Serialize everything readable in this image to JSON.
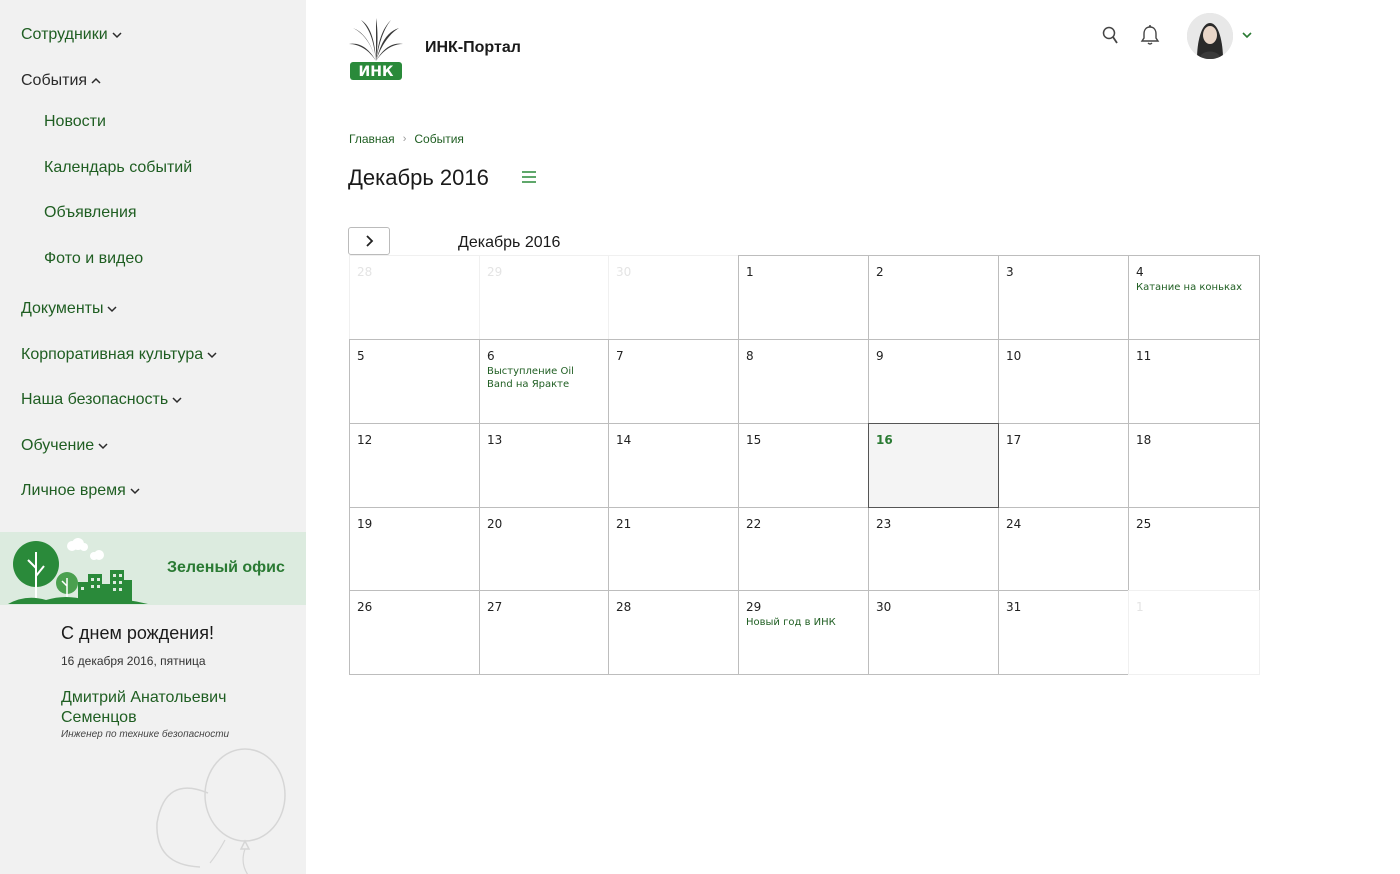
{
  "sidebar": {
    "items": [
      {
        "label": "Сотрудники",
        "state": "collapsed"
      },
      {
        "label": "События",
        "state": "expanded"
      },
      {
        "label": "Документы",
        "state": "collapsed"
      },
      {
        "label": "Корпоративная культура",
        "state": "collapsed"
      },
      {
        "label": "Наша безопасность",
        "state": "collapsed"
      },
      {
        "label": "Обучение",
        "state": "collapsed"
      },
      {
        "label": "Личное время",
        "state": "collapsed"
      }
    ],
    "events_subitems": [
      "Новости",
      "Календарь событий",
      "Объявления",
      "Фото и видео"
    ],
    "green_office": {
      "label": "Зеленый офис"
    },
    "birthday": {
      "title": "С днем рождения!",
      "date": "16 декабря 2016, пятница",
      "name": "Дмитрий Анатольевич Семенцов",
      "role": "Инженер по технике безопасности"
    }
  },
  "header": {
    "logo_text": "ИНК",
    "portal_title": "ИНК-Портал",
    "icons": [
      "search-icon",
      "bell-icon"
    ]
  },
  "breadcrumb": [
    "Главная",
    "События"
  ],
  "page": {
    "title": "Декабрь 2016"
  },
  "calendar": {
    "month_label": "Декабрь 2016",
    "weeks": [
      [
        {
          "d": "28",
          "other": true
        },
        {
          "d": "29",
          "other": true
        },
        {
          "d": "30",
          "other": true
        },
        {
          "d": "1"
        },
        {
          "d": "2"
        },
        {
          "d": "3"
        },
        {
          "d": "4",
          "event": "Катание на коньках"
        }
      ],
      [
        {
          "d": "5"
        },
        {
          "d": "6",
          "event": "Выступление Oil Band на Яракте"
        },
        {
          "d": "7"
        },
        {
          "d": "8"
        },
        {
          "d": "9"
        },
        {
          "d": "10"
        },
        {
          "d": "11"
        }
      ],
      [
        {
          "d": "12"
        },
        {
          "d": "13"
        },
        {
          "d": "14"
        },
        {
          "d": "15"
        },
        {
          "d": "16",
          "today": true
        },
        {
          "d": "17"
        },
        {
          "d": "18"
        }
      ],
      [
        {
          "d": "19"
        },
        {
          "d": "20"
        },
        {
          "d": "21"
        },
        {
          "d": "22"
        },
        {
          "d": "23"
        },
        {
          "d": "24"
        },
        {
          "d": "25"
        }
      ],
      [
        {
          "d": "26"
        },
        {
          "d": "27"
        },
        {
          "d": "28"
        },
        {
          "d": "29",
          "event": "Новый год в ИНК"
        },
        {
          "d": "30"
        },
        {
          "d": "31"
        },
        {
          "d": "1",
          "other": true
        }
      ]
    ]
  },
  "colors": {
    "brand_green": "#1f5e22",
    "accent_green": "#2a7a33",
    "sidebar_bg": "#f1f1f1",
    "banner_bg": "#dcebdf"
  }
}
